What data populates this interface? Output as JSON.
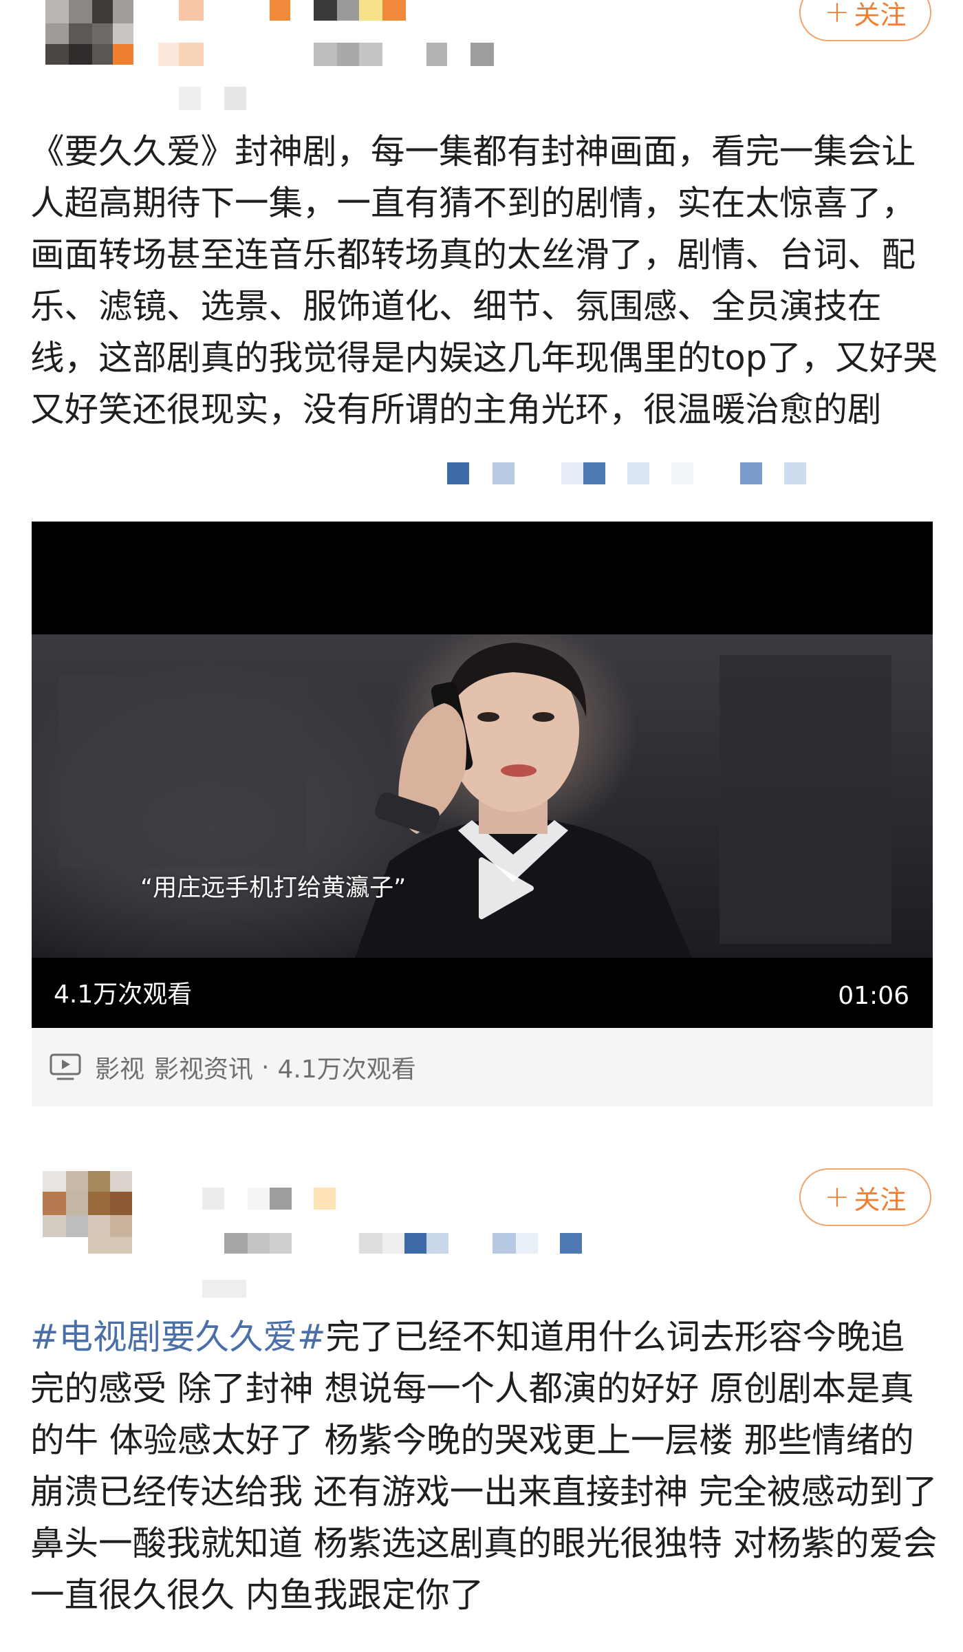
{
  "post1": {
    "follow_label": "关注",
    "text": "《要久久爱》封神剧，每一集都有封神画面，看完一集会让人超高期待下一集，一直有猜不到的剧情，实在太惊喜了，画面转场甚至连音乐都转场真的太丝滑了，剧情、台词、配乐、滤镜、选景、服饰道化、细节、氛围感、全员演技在线，这部剧真的我觉得是内娱这几年现偶里的top了，又好哭又好笑还很现实，没有所谓的主角光环，很温暖治愈的剧"
  },
  "video": {
    "caption": "“用庄远手机打给黄瀛子”",
    "views": "4.1万次观看",
    "duration": "01:06",
    "source_category": "影视",
    "source_channel": "影视资讯",
    "source_separator": "·",
    "source_views": "4.1万次观看"
  },
  "post2": {
    "follow_label": "关注",
    "hashtag": "#电视剧要久久爱#",
    "text": "完了已经不知道用什么词去形容今晚追完的感受 除了封神 想说每一个人都演的好好 原创剧本是真的牛 体验感太好了 杨紫今晚的哭戏更上一层楼 那些情绪的崩溃已经传达给我 还有游戏一出来直接封神 完全被感动到了 鼻头一酸我就知道 杨紫选这剧真的眼光很独特 对杨紫的爱会一直很久很久 内鱼我跟定你了"
  },
  "colors": {
    "accent_orange": "#f07f31",
    "hashtag_blue": "#4a6fa8",
    "text_dark": "#1e1e1e",
    "meta_gray": "#6f6f6f"
  },
  "icons": {
    "follow_plus": "plus-icon",
    "play": "play-icon",
    "source": "video-tv-icon"
  }
}
